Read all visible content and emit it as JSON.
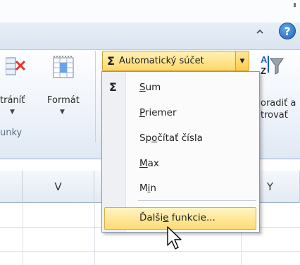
{
  "ribbon": {
    "delete_label": "tráníť",
    "format_label": "Formát",
    "group_label": "unky",
    "sort_label_line1": "oradiť a",
    "sort_label_line2": "trovať",
    "autosum_label": "Automatický súčet"
  },
  "autosum_menu": {
    "items": [
      {
        "label": "Sum",
        "accel": "S",
        "rest": "um"
      },
      {
        "label": "Priemer",
        "accel": "P",
        "rest": "riemer"
      },
      {
        "label": "Spočítať čísla",
        "pre": "Sp",
        "accel": "o",
        "rest": "čítať čísla"
      },
      {
        "label": "Max",
        "accel": "M",
        "rest": "ax"
      },
      {
        "label": "Min",
        "pre": "M",
        "accel": "i",
        "rest": "n"
      }
    ],
    "more": {
      "label": "Ďalšie funkcie...",
      "pre": "Ďalši",
      "accel": "e",
      "rest": " funkcie..."
    }
  },
  "sheet": {
    "columns": [
      "V",
      "Y"
    ]
  },
  "icons": {
    "autosum": "sigma-icon",
    "help": "help-icon",
    "minimize": "chevron-up-icon",
    "delete": "delete-cells-icon",
    "format": "format-cells-icon",
    "sort": "sort-filter-icon",
    "cursor": "mouse-pointer-icon"
  },
  "colors": {
    "highlight": "#ffdb73",
    "ribbon_bg": "#eef3fa",
    "menu_bg": "#fbfbfb"
  }
}
